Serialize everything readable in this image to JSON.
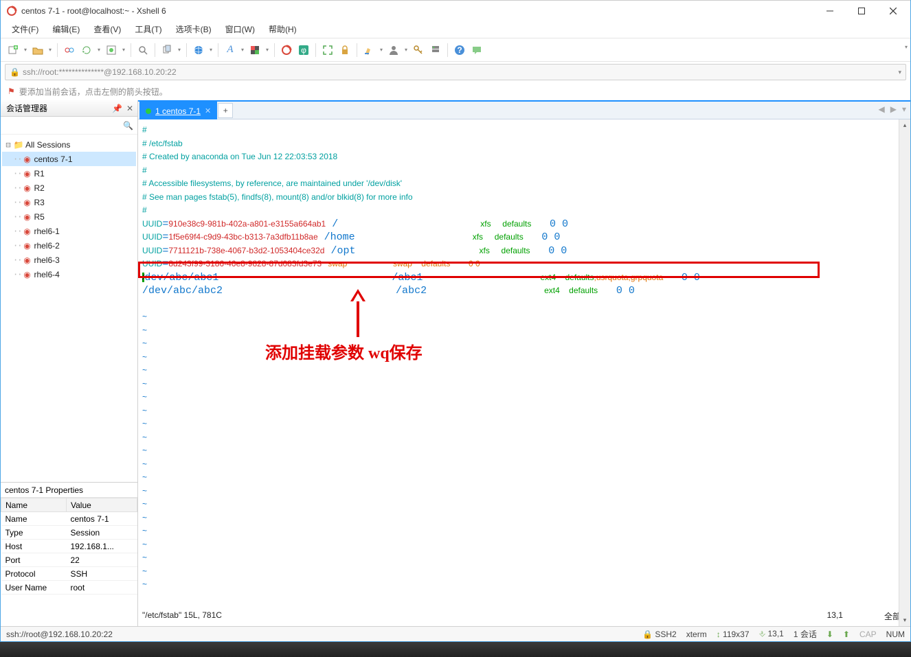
{
  "window": {
    "title": "centos 7-1 - root@localhost:~ - Xshell 6"
  },
  "menu": [
    "文件(F)",
    "编辑(E)",
    "查看(V)",
    "工具(T)",
    "选项卡(B)",
    "窗口(W)",
    "帮助(H)"
  ],
  "address": {
    "text": "ssh://root:**************@192.168.10.20:22"
  },
  "hint": "要添加当前会话，点击左侧的箭头按钮。",
  "session_panel": {
    "title": "会话管理器",
    "root": "All Sessions",
    "items": [
      "centos 7-1",
      "R1",
      "R2",
      "R3",
      "R5",
      "rhel6-1",
      "rhel6-2",
      "rhel6-3",
      "rhel6-4"
    ],
    "selected_index": 0
  },
  "properties": {
    "title": "centos 7-1 Properties",
    "headers": [
      "Name",
      "Value"
    ],
    "rows": [
      [
        "Name",
        "centos 7-1"
      ],
      [
        "Type",
        "Session"
      ],
      [
        "Host",
        "192.168.1..."
      ],
      [
        "Port",
        "22"
      ],
      [
        "Protocol",
        "SSH"
      ],
      [
        "User Name",
        "root"
      ]
    ]
  },
  "tabs": {
    "active": "1 centos 7-1"
  },
  "terminal": {
    "lines": [
      {
        "segs": [
          {
            "t": "#",
            "c": "c-cyan"
          }
        ]
      },
      {
        "segs": [
          {
            "t": "# /etc/fstab",
            "c": "c-cyan"
          }
        ]
      },
      {
        "segs": [
          {
            "t": "# Created by anaconda on Tue Jun 12 22:03:53 2018",
            "c": "c-cyan"
          }
        ]
      },
      {
        "segs": [
          {
            "t": "#",
            "c": "c-cyan"
          }
        ]
      },
      {
        "segs": [
          {
            "t": "# Accessible filesystems, by reference, are maintained under '/dev/disk'",
            "c": "c-cyan"
          }
        ]
      },
      {
        "segs": [
          {
            "t": "# See man pages fstab(5), findfs(8), mount(8) and/or blkid(8) for more info",
            "c": "c-cyan"
          }
        ]
      },
      {
        "segs": [
          {
            "t": "#",
            "c": "c-cyan"
          }
        ]
      },
      {
        "segs": [
          {
            "t": "UUID",
            "c": "c-cyan"
          },
          {
            "t": "=",
            "c": ""
          },
          {
            "t": "910e38c9-981b-402a-a801-e3155a664ab1",
            "c": "c-red"
          },
          {
            "t": " /                       ",
            "c": ""
          },
          {
            "t": "xfs     ",
            "c": "c-green"
          },
          {
            "t": "defaults        ",
            "c": "c-green"
          },
          {
            "t": "0 0",
            "c": ""
          }
        ]
      },
      {
        "segs": [
          {
            "t": "UUID",
            "c": "c-cyan"
          },
          {
            "t": "=",
            "c": ""
          },
          {
            "t": "1f5e69f4-c9d9-43bc-b313-7a3dfb11b8ae",
            "c": "c-red"
          },
          {
            "t": " /home                   ",
            "c": ""
          },
          {
            "t": "xfs     ",
            "c": "c-green"
          },
          {
            "t": "defaults        ",
            "c": "c-green"
          },
          {
            "t": "0 0",
            "c": ""
          }
        ]
      },
      {
        "segs": [
          {
            "t": "UUID",
            "c": "c-cyan"
          },
          {
            "t": "=",
            "c": ""
          },
          {
            "t": "7711121b-738e-4067-b3d2-1053404ce32d",
            "c": "c-red"
          },
          {
            "t": " /opt                    ",
            "c": ""
          },
          {
            "t": "xfs     ",
            "c": "c-green"
          },
          {
            "t": "defaults        ",
            "c": "c-green"
          },
          {
            "t": "0 0",
            "c": ""
          }
        ]
      },
      {
        "segs": [
          {
            "t": "UUID",
            "c": "c-cyan"
          },
          {
            "t": "=",
            "c": ""
          },
          {
            "t": "8d243f99-3186-46e8-9828-87d083fd3e73",
            "c": "c-red"
          },
          {
            "t": " ",
            "c": ""
          },
          {
            "t": "swap                    swap    defaults        0 0",
            "c": "c-orange"
          }
        ]
      },
      {
        "segs": [
          {
            "t": "/",
            "c": "cursor"
          },
          {
            "t": "dev/abc/abc1",
            "c": ""
          },
          {
            "t": "                            /abc1                   ",
            "c": ""
          },
          {
            "t": "ext4    ",
            "c": "c-green"
          },
          {
            "t": "defaults",
            "c": "c-green"
          },
          {
            "t": ",usrquota,grpquota        ",
            "c": "c-orange"
          },
          {
            "t": "0 0",
            "c": ""
          }
        ]
      },
      {
        "segs": [
          {
            "t": "/dev/abc/abc2                            /abc2                   ",
            "c": ""
          },
          {
            "t": "ext4    ",
            "c": "c-green"
          },
          {
            "t": "defaults        ",
            "c": "c-green"
          },
          {
            "t": "0 0",
            "c": ""
          }
        ]
      }
    ],
    "tilde_count": 21,
    "vim_status_left": "\"/etc/fstab\" 15L, 781C",
    "vim_status_pos": "13,1",
    "vim_status_right": "全部",
    "annotation": "添加挂载参数  wq保存"
  },
  "statusbar": {
    "left": "ssh://root@192.168.10.20:22",
    "ssh": "SSH2",
    "emu": "xterm",
    "size": "119x37",
    "cursor": "13,1",
    "sess": "1 会话",
    "cap": "CAP",
    "num": "NUM"
  }
}
